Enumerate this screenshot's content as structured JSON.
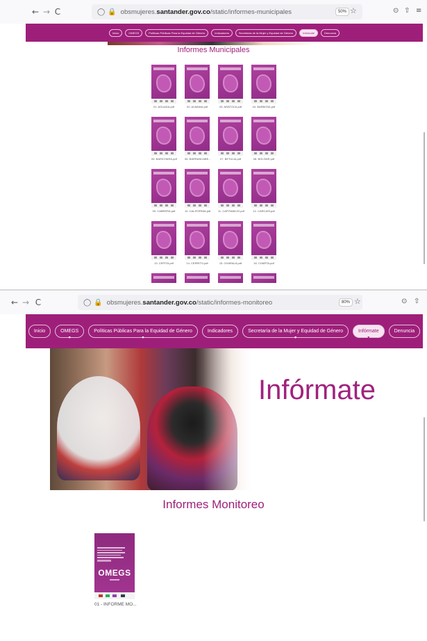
{
  "top_view": {
    "browser": {
      "back": "←",
      "forward": "→",
      "reload": "C",
      "url_prefix": "obsmujeres.",
      "url_domain": "santander.gov.co",
      "url_path": "/static/informes-municipales",
      "zoom": "50%",
      "right_icons": [
        "⊙",
        "⇧",
        "≡"
      ]
    },
    "nav": [
      "Inicio",
      "OMEGS",
      "Políticas Públicas Para la Equidad de Género",
      "Indicadores",
      "Secretaría de la Mujer y Equidad de Género",
      "Infórmate",
      "Denuncia"
    ],
    "nav_active_index": 5,
    "section_title": "Informes Municipales",
    "reports": [
      "01. AGUADA.pdf",
      "02. ALBANIA.pdf",
      "03. ARATOCA.pdf",
      "04. BARBOSA.pdf",
      "05. BARICHARA.pdf",
      "06. BARRANCABE...",
      "07. BETULIA.pdf",
      "08. BOLÍVAR.pdf",
      "09. CABRERA.pdf",
      "10. CALIFORNIA.pdf",
      "11. CAPITANEJO.pdf",
      "12. CARCASÍ.pdf",
      "13. CEPITÁ.pdf",
      "14. CERRITO.pdf",
      "15. CHARALÁ.pdf",
      "16. CHARTA.pdf"
    ]
  },
  "bottom_view": {
    "browser": {
      "back": "←",
      "forward": "→",
      "reload": "C",
      "url_prefix": "obsmujeres.",
      "url_domain": "santander.gov.co",
      "url_path": "/static/informes-monitoreo",
      "zoom": "80%",
      "right_icons": [
        "⊙",
        "⇧"
      ]
    },
    "nav": [
      "Inicio",
      "OMEGS",
      "Políticas Públicas Para la Equidad de Género",
      "Indicadores",
      "Secretaría de la Mujer y Equidad de Género",
      "Infórmate",
      "Denuncia"
    ],
    "nav_dropdown": [
      false,
      true,
      true,
      false,
      true,
      true,
      false
    ],
    "nav_active_index": 5,
    "hero_text": "Infórmate",
    "section_title": "Informes Monitoreo",
    "report": {
      "cover_logo": "OMEGS",
      "caption": "01 - INFORME MO..."
    }
  },
  "colors": {
    "brand_magenta": "#9e1f7a",
    "hero_text": "#a0227e",
    "cover_purple": "#a33592"
  }
}
